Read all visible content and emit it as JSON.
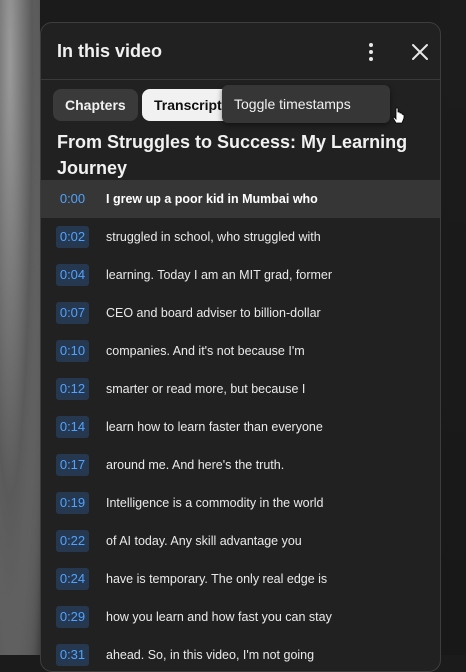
{
  "panel": {
    "title": "In this video",
    "more_icon": "vertical-ellipsis",
    "close_icon": "close-x"
  },
  "chips": [
    {
      "label": "Chapters",
      "selected": false
    },
    {
      "label": "Transcript",
      "selected": true
    }
  ],
  "tooltip": {
    "text": "Toggle timestamps"
  },
  "video_title": "From Struggles to Success: My Learning Journey",
  "segments": [
    {
      "time": "0:00",
      "text": "I grew up a poor kid in Mumbai who",
      "active": true
    },
    {
      "time": "0:02",
      "text": "struggled in school, who struggled with",
      "active": false
    },
    {
      "time": "0:04",
      "text": "learning. Today I am an MIT grad, former",
      "active": false
    },
    {
      "time": "0:07",
      "text": "CEO and board adviser to billion-dollar",
      "active": false
    },
    {
      "time": "0:10",
      "text": "companies. And it's not because I'm",
      "active": false
    },
    {
      "time": "0:12",
      "text": "smarter or read more, but because I",
      "active": false
    },
    {
      "time": "0:14",
      "text": "learn how to learn faster than everyone",
      "active": false
    },
    {
      "time": "0:17",
      "text": "around me. And here's the truth.",
      "active": false
    },
    {
      "time": "0:19",
      "text": "Intelligence is a commodity in the world",
      "active": false
    },
    {
      "time": "0:22",
      "text": "of AI today. Any skill advantage you",
      "active": false
    },
    {
      "time": "0:24",
      "text": "have is temporary. The only real edge is",
      "active": false
    },
    {
      "time": "0:29",
      "text": "how you learn and how fast you can stay",
      "active": false
    },
    {
      "time": "0:31",
      "text": "ahead. So, in this video, I'm not going",
      "active": false
    }
  ],
  "colors": {
    "panel_bg": "#212121",
    "timestamp_text": "#4fa3ff",
    "timestamp_bg": "#263850",
    "active_row_bg": "#363636"
  }
}
